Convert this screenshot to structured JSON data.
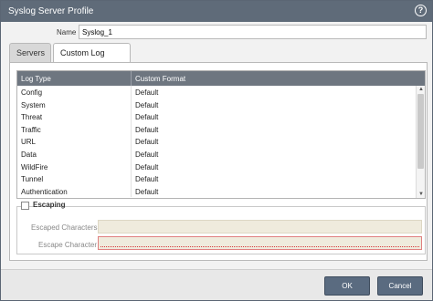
{
  "dialog": {
    "title": "Syslog Server Profile",
    "help_glyph": "?"
  },
  "name_field": {
    "label": "Name",
    "value": "Syslog_1"
  },
  "tabs": [
    {
      "label": "Servers",
      "active": false
    },
    {
      "label": "Custom Log Format",
      "active": true
    }
  ],
  "grid": {
    "columns": [
      "Log Type",
      "Custom Format"
    ],
    "rows": [
      [
        "Config",
        "Default"
      ],
      [
        "System",
        "Default"
      ],
      [
        "Threat",
        "Default"
      ],
      [
        "Traffic",
        "Default"
      ],
      [
        "URL",
        "Default"
      ],
      [
        "Data",
        "Default"
      ],
      [
        "WildFire",
        "Default"
      ],
      [
        "Tunnel",
        "Default"
      ],
      [
        "Authentication",
        "Default"
      ]
    ]
  },
  "escaping": {
    "label": "Escaping",
    "checked": false,
    "escaped_characters_label": "Escaped Characters",
    "escaped_characters_value": "",
    "escape_character_label": "Escape Character",
    "escape_character_value": ""
  },
  "footer": {
    "ok_label": "OK",
    "cancel_label": "Cancel"
  },
  "colors": {
    "titlebar": "#5f6b79",
    "grid_header": "#6e7680",
    "button": "#5a6b80",
    "disabled_input": "#efebdd",
    "error_border": "#d43a3a"
  },
  "icons": {
    "help": "help-icon",
    "scroll_up": "scroll-up-arrow-icon",
    "scroll_down": "scroll-down-arrow-icon"
  }
}
